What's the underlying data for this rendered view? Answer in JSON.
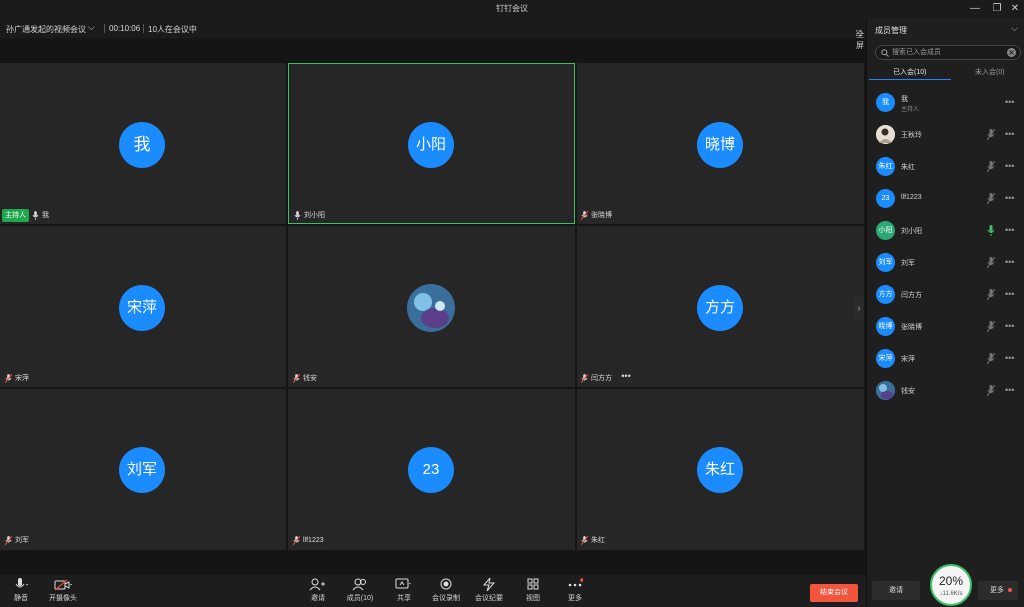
{
  "window": {
    "title": "钉钉会议"
  },
  "meeting": {
    "title": "孙广通发起的视频会议",
    "duration": "00:10:06",
    "attendance": "10人在会议中",
    "fullscreen_label": "全屏"
  },
  "tiles": [
    {
      "avatar_text": "我",
      "name": "我",
      "host_label": "主持人"
    },
    {
      "avatar_text": "小阳",
      "name": "刘小阳"
    },
    {
      "avatar_text": "晓博",
      "name": "张晓博"
    },
    {
      "avatar_text": "宋萍",
      "name": "宋萍"
    },
    {
      "avatar_text": "",
      "name": "钱安"
    },
    {
      "avatar_text": "方方",
      "name": "闫方方",
      "more": "•••"
    },
    {
      "avatar_text": "刘军",
      "name": "刘军"
    },
    {
      "avatar_text": "23",
      "name": "llf1223"
    },
    {
      "avatar_text": "朱红",
      "name": "朱红"
    }
  ],
  "toolbar": {
    "mute": "静音",
    "camera": "开摄像头",
    "invite": "邀请",
    "members": "成员(10)",
    "share": "共享",
    "record": "会议录制",
    "minutes": "会议纪要",
    "view": "视图",
    "more": "更多",
    "end": "结束会议"
  },
  "panel": {
    "title": "成员管理",
    "search_placeholder": "搜索已入会成员",
    "tab_joined": "已入会(10)",
    "tab_not_joined": "未入会(0)",
    "members": [
      {
        "avatar": "我",
        "name": "我",
        "sub": "主持人"
      },
      {
        "avatar": "",
        "name": "王秋玲"
      },
      {
        "avatar": "朱红",
        "name": "朱红"
      },
      {
        "avatar": "23",
        "name": "llf1223"
      },
      {
        "avatar": "小阳",
        "name": "刘小阳"
      },
      {
        "avatar": "刘军",
        "name": "刘军"
      },
      {
        "avatar": "方方",
        "name": "闫方方"
      },
      {
        "avatar": "晓博",
        "name": "张晓博"
      },
      {
        "avatar": "宋萍",
        "name": "宋萍"
      },
      {
        "avatar": "",
        "name": "钱安"
      }
    ],
    "more_dots": "•••",
    "invite": "邀请",
    "more": "更多"
  },
  "network": {
    "percent": "20%",
    "speed": "↓11.6K/s"
  },
  "colors": {
    "accent": "#1a8cff",
    "active_border": "#3fbf68",
    "end": "#f2553c",
    "host": "#1fa74d"
  }
}
